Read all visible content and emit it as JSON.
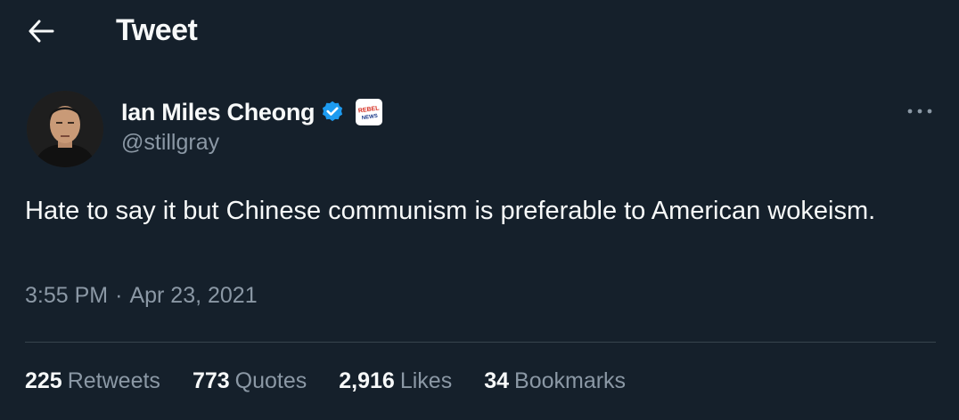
{
  "header": {
    "title": "Tweet",
    "back_icon": "arrow-left-icon"
  },
  "author": {
    "display_name": "Ian Miles Cheong",
    "handle": "@stillgray",
    "verified": true,
    "verified_icon": "verified-badge-icon",
    "affiliate_badge": "rebel-news-badge",
    "affiliate_text": "REBEL NEWS"
  },
  "tweet": {
    "text": "Hate to say it but Chinese communism is preferable to American wokeism.",
    "time": "3:55 PM",
    "separator": "·",
    "date": "Apr 23, 2021"
  },
  "stats": [
    {
      "count": "225",
      "label": "Retweets"
    },
    {
      "count": "773",
      "label": "Quotes"
    },
    {
      "count": "2,916",
      "label": "Likes"
    },
    {
      "count": "34",
      "label": "Bookmarks"
    }
  ],
  "colors": {
    "background": "#15202b",
    "text_primary": "#f7f9f9",
    "text_secondary": "#8b98a5",
    "divider": "#38444d",
    "verified": "#1d9bf0",
    "rebel_red": "#d52b1e"
  }
}
